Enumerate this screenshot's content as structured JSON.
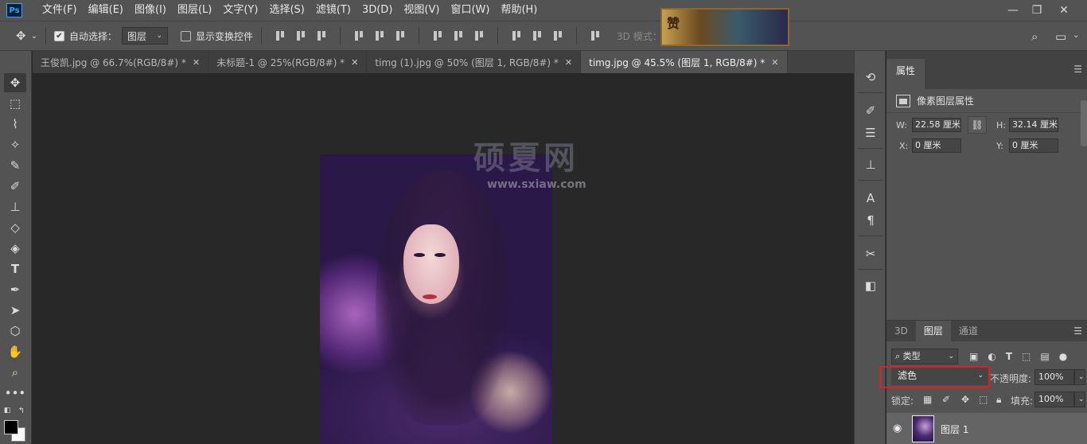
{
  "app": {
    "logo": "Ps"
  },
  "menu": [
    "文件(F)",
    "编辑(E)",
    "图像(I)",
    "图层(L)",
    "文字(Y)",
    "选择(S)",
    "滤镜(T)",
    "3D(D)",
    "视图(V)",
    "窗口(W)",
    "帮助(H)"
  ],
  "banner": {
    "text": "赞"
  },
  "window_controls": {
    "minimize": "—",
    "restore": "❐",
    "close": "✕"
  },
  "options": {
    "auto_select_label": "自动选择：",
    "auto_select_value": "图层",
    "show_transform_label": "显示变换控件",
    "mode_3d_label": "3D 模式："
  },
  "tabs": [
    {
      "label": "王俊凯.jpg @ 66.7%(RGB/8#) *"
    },
    {
      "label": "未标题-1 @ 25%(RGB/8#) *"
    },
    {
      "label": "timg (1).jpg @ 50% (图层 1, RGB/8#) *"
    },
    {
      "label": "timg.jpg @ 45.5% (图层 1, RGB/8#) *"
    }
  ],
  "watermark": {
    "title": "硕夏网",
    "url": "www.sxiaw.com"
  },
  "properties": {
    "tab": "属性",
    "subtitle": "像素图层属性",
    "w_label": "W:",
    "w_value": "22.58 厘米",
    "h_label": "H:",
    "h_value": "32.14 厘米",
    "x_label": "X:",
    "x_value": "0 厘米",
    "y_label": "Y:",
    "y_value": "0 厘米"
  },
  "layers": {
    "tabs": [
      "3D",
      "图层",
      "通道"
    ],
    "filter_kind": "类型",
    "blend_mode": "滤色",
    "opacity_label": "不透明度:",
    "opacity_value": "100%",
    "lock_label": "锁定:",
    "fill_label": "填充:",
    "fill_value": "100%",
    "layer_name": "图层 1"
  }
}
